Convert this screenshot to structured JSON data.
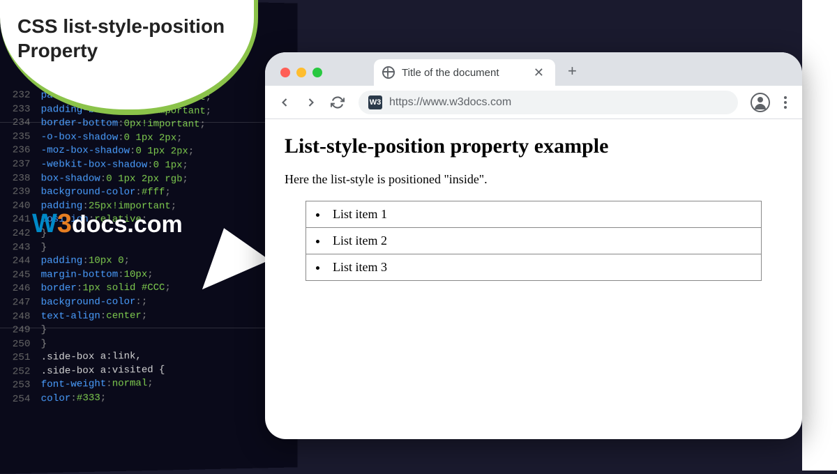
{
  "bubble": {
    "title": "CSS list-style-position Property"
  },
  "logo": {
    "w": "W",
    "three": "3",
    "rest": "docs.com"
  },
  "browser": {
    "tab_title": "Title of the document",
    "url": "https://www.w3docs.com",
    "site_badge": "W3"
  },
  "page": {
    "heading": "List-style-position property example",
    "paragraph": "Here the list-style is positioned \"inside\".",
    "list_items": [
      "List item 1",
      "List item 2",
      "List item 3"
    ]
  },
  "code_lines": [
    {
      "num": "232",
      "prop": "padding-bottom",
      "val": "0px!important"
    },
    {
      "num": "233",
      "prop": "padding-bottom",
      "val": "0px!important"
    },
    {
      "num": "234",
      "prop": "border-bottom",
      "val": "0px!important"
    },
    {
      "num": "235",
      "prop": "-o-box-shadow",
      "val": "0 1px 2px"
    },
    {
      "num": "236",
      "prop": "-moz-box-shadow",
      "val": "0 1px 2px"
    },
    {
      "num": "237",
      "prop": "-webkit-box-shadow",
      "val": "0 1px"
    },
    {
      "num": "238",
      "prop": "box-shadow",
      "val": "0 1px 2px rgb"
    },
    {
      "num": "239",
      "prop": "background-color",
      "val": "#fff"
    },
    {
      "num": "240",
      "prop": "padding",
      "val": "25px!important"
    },
    {
      "num": "241",
      "prop": "position",
      "val": "relative"
    },
    {
      "num": "242",
      "prop": "",
      "val": ""
    },
    {
      "num": "243",
      "prop": "",
      "val": ""
    },
    {
      "num": "244",
      "prop": "padding",
      "val": "10px 0"
    },
    {
      "num": "245",
      "prop": "margin-bottom",
      "val": "10px"
    },
    {
      "num": "246",
      "prop": "border",
      "val": "1px solid #CCC"
    },
    {
      "num": "247",
      "prop": "background-color",
      "val": ""
    },
    {
      "num": "248",
      "prop": "text-align",
      "val": "center"
    },
    {
      "num": "249",
      "prop": "",
      "val": ""
    },
    {
      "num": "250",
      "prop": "",
      "val": ""
    },
    {
      "num": "251",
      "sel": ".side-box a:link,"
    },
    {
      "num": "252",
      "sel": ".side-box a:visited {"
    },
    {
      "num": "253",
      "prop": "font-weight",
      "val": "normal"
    },
    {
      "num": "254",
      "prop": "color",
      "val": "#333"
    }
  ]
}
